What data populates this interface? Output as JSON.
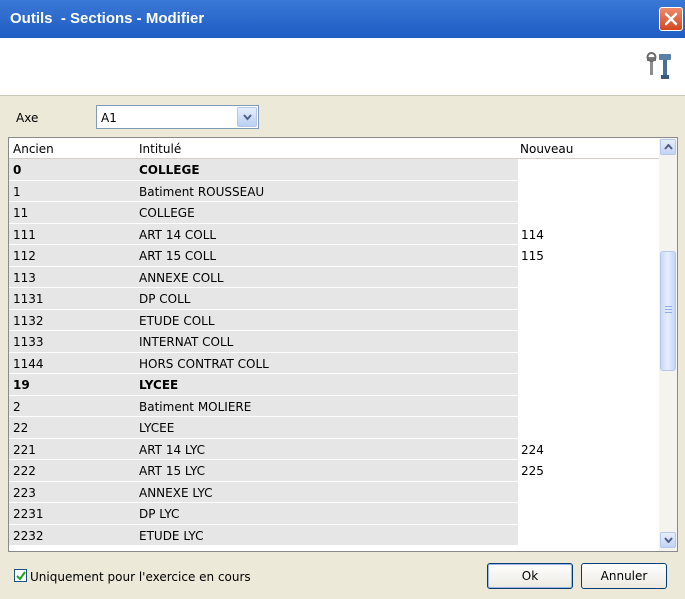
{
  "window": {
    "title": "Outils  - Sections - Modifier"
  },
  "axe": {
    "label": "Axe",
    "value": "A1"
  },
  "table": {
    "headers": {
      "ancien": "Ancien",
      "intitule": "Intitulé",
      "nouveau": "Nouveau"
    },
    "rows": [
      {
        "ancien": "0",
        "intitule": "COLLEGE",
        "nouveau": "",
        "bold": true
      },
      {
        "ancien": "1",
        "intitule": "Batiment ROUSSEAU",
        "nouveau": ""
      },
      {
        "ancien": "11",
        "intitule": "COLLEGE",
        "nouveau": ""
      },
      {
        "ancien": "111",
        "intitule": "ART 14 COLL",
        "nouveau": "114"
      },
      {
        "ancien": "112",
        "intitule": "ART 15 COLL",
        "nouveau": "115"
      },
      {
        "ancien": "113",
        "intitule": "ANNEXE COLL",
        "nouveau": ""
      },
      {
        "ancien": "1131",
        "intitule": "DP COLL",
        "nouveau": ""
      },
      {
        "ancien": "1132",
        "intitule": "ETUDE COLL",
        "nouveau": ""
      },
      {
        "ancien": "1133",
        "intitule": "INTERNAT COLL",
        "nouveau": ""
      },
      {
        "ancien": "1144",
        "intitule": "HORS CONTRAT COLL",
        "nouveau": ""
      },
      {
        "ancien": "19",
        "intitule": "LYCEE",
        "nouveau": "",
        "bold": true
      },
      {
        "ancien": "2",
        "intitule": "Batiment MOLIERE",
        "nouveau": ""
      },
      {
        "ancien": "22",
        "intitule": "LYCEE",
        "nouveau": ""
      },
      {
        "ancien": "221",
        "intitule": "ART 14 LYC",
        "nouveau": "224"
      },
      {
        "ancien": "222",
        "intitule": "ART 15 LYC",
        "nouveau": "225"
      },
      {
        "ancien": "223",
        "intitule": "ANNEXE LYC",
        "nouveau": ""
      },
      {
        "ancien": "2231",
        "intitule": "DP LYC",
        "nouveau": ""
      },
      {
        "ancien": "2232",
        "intitule": "ETUDE LYC",
        "nouveau": ""
      }
    ]
  },
  "footer": {
    "checkbox_label": "Uniquement pour l'exercice en cours",
    "checkbox_checked": true,
    "ok_label": "Ok",
    "cancel_label": "Annuler"
  },
  "icons": {
    "close": "close-icon",
    "tools": "tools-icon",
    "dropdown": "chevron-down-icon"
  }
}
